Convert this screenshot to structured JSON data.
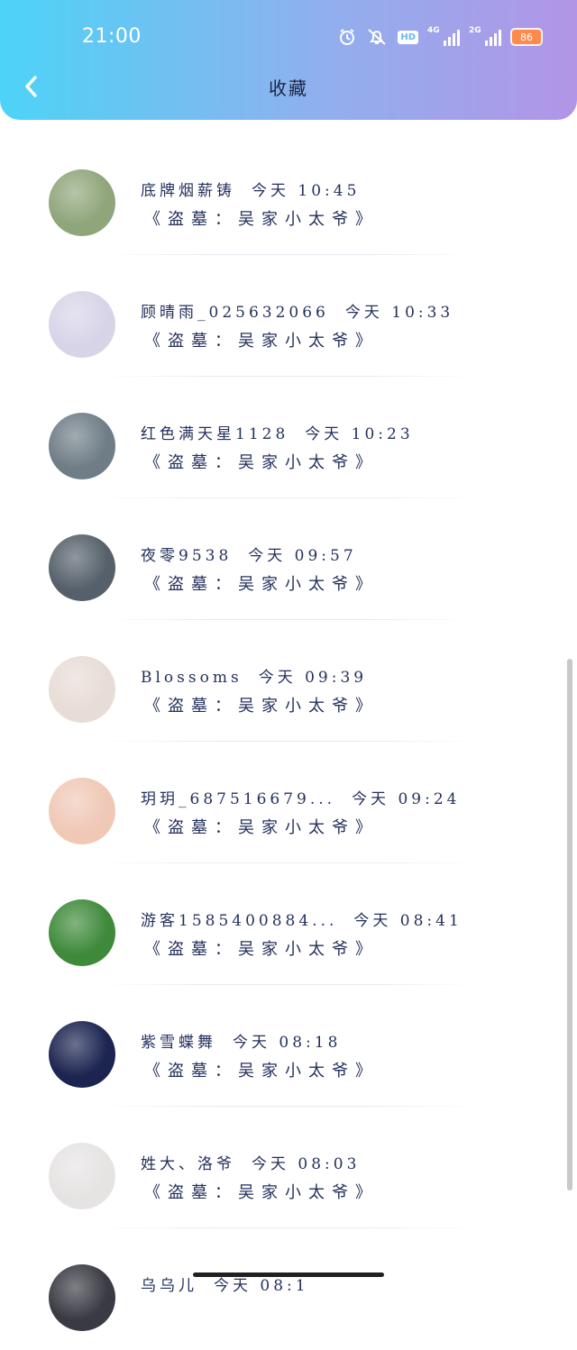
{
  "status_bar": {
    "time": "21:00",
    "network_1": "4G",
    "network_2": "2G",
    "hd_label": "HD",
    "battery": "86"
  },
  "header": {
    "title": "收藏"
  },
  "icons": {
    "back": "chevron-left-icon",
    "alarm": "alarm-icon",
    "mute": "bell-off-icon"
  },
  "items": [
    {
      "user": "底牌烟薪铸",
      "time": "今天 10:45",
      "work": "《盗墓：吴家小太爷》",
      "avatar_color": "#8fa57a"
    },
    {
      "user": "顾晴雨_025632066",
      "time": "今天 10:33",
      "work": "《盗墓：吴家小太爷》",
      "avatar_color": "#d8d4e8"
    },
    {
      "user": "红色满天星1128",
      "time": "今天 10:23",
      "work": "《盗墓：吴家小太爷》",
      "avatar_color": "#6f7d86"
    },
    {
      "user": "夜零9538",
      "time": "今天 09:57",
      "work": "《盗墓：吴家小太爷》",
      "avatar_color": "#55606a"
    },
    {
      "user": "Blossoms",
      "time": "今天 09:39",
      "work": "《盗墓：吴家小太爷》",
      "avatar_color": "#e8dcd6"
    },
    {
      "user": "玥玥_687516679...",
      "time": "今天 09:24",
      "work": "《盗墓：吴家小太爷》",
      "avatar_color": "#f0c8b6"
    },
    {
      "user": "游客1585400884...",
      "time": "今天 08:41",
      "work": "《盗墓：吴家小太爷》",
      "avatar_color": "#3e8a3a"
    },
    {
      "user": "紫雪蝶舞",
      "time": "今天 08:18",
      "work": "《盗墓：吴家小太爷》",
      "avatar_color": "#1c2450"
    },
    {
      "user": "姓大、洛爷",
      "time": "今天 08:03",
      "work": "《盗墓：吴家小太爷》",
      "avatar_color": "#e6e3e3"
    },
    {
      "user": "乌乌儿",
      "time": "今天 08:1",
      "work": "",
      "avatar_color": "#3a3a44"
    }
  ]
}
